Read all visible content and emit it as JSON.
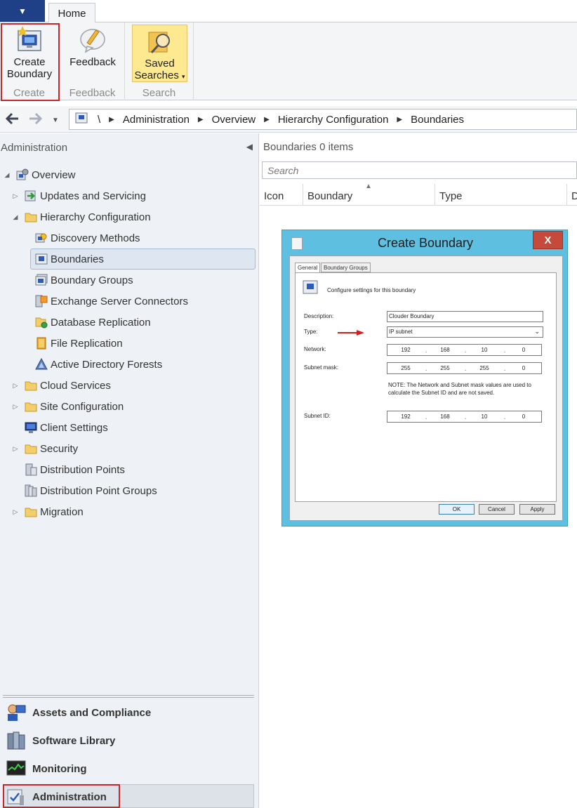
{
  "ribbon": {
    "home_tab": "Home",
    "groups": [
      {
        "label": "Create",
        "button": "Create Boundary"
      },
      {
        "label": "Feedback",
        "button": "Feedback"
      },
      {
        "label": "Search",
        "button": "Saved Searches"
      }
    ],
    "create_line1": "Create",
    "create_line2": "Boundary",
    "saved_line1": "Saved",
    "saved_line2": "Searches"
  },
  "address": {
    "root": "\\",
    "crumbs": [
      "Administration",
      "Overview",
      "Hierarchy Configuration",
      "Boundaries"
    ]
  },
  "nav": {
    "title": "Administration",
    "items": [
      {
        "label": "Overview",
        "icon": "overview-icon"
      },
      {
        "label": "Updates and Servicing",
        "icon": "updates-icon"
      },
      {
        "label": "Hierarchy Configuration",
        "icon": "folder-icon"
      },
      {
        "label": "Discovery Methods",
        "icon": "discovery-icon"
      },
      {
        "label": "Boundaries",
        "icon": "boundary-icon"
      },
      {
        "label": "Boundary Groups",
        "icon": "boundary-group-icon"
      },
      {
        "label": "Exchange Server Connectors",
        "icon": "exchange-icon"
      },
      {
        "label": "Database Replication",
        "icon": "database-icon"
      },
      {
        "label": "File Replication",
        "icon": "file-replication-icon"
      },
      {
        "label": "Active Directory Forests",
        "icon": "forest-icon"
      },
      {
        "label": "Cloud Services",
        "icon": "folder-icon"
      },
      {
        "label": "Site Configuration",
        "icon": "folder-icon"
      },
      {
        "label": "Client Settings",
        "icon": "monitor-icon"
      },
      {
        "label": "Security",
        "icon": "folder-icon"
      },
      {
        "label": "Distribution Points",
        "icon": "server-icon"
      },
      {
        "label": "Distribution Point Groups",
        "icon": "server-group-icon"
      },
      {
        "label": "Migration",
        "icon": "folder-icon"
      }
    ],
    "workspaces": [
      {
        "label": "Assets and Compliance",
        "icon": "assets-icon"
      },
      {
        "label": "Software Library",
        "icon": "library-icon"
      },
      {
        "label": "Monitoring",
        "icon": "monitoring-icon"
      },
      {
        "label": "Administration",
        "icon": "administration-icon"
      }
    ]
  },
  "content": {
    "title": "Boundaries",
    "count": "0 items",
    "search_placeholder": "Search",
    "columns": [
      "Icon",
      "Boundary",
      "Type",
      "D"
    ]
  },
  "dialog": {
    "title": "Create Boundary",
    "close": "X",
    "tabs": [
      "General",
      "Boundary Groups"
    ],
    "intro": "Configure settings for this boundary",
    "description_label": "Description:",
    "description_value": "Clouder Boundary",
    "type_label": "Type:",
    "type_value": "IP subnet",
    "network_label": "Network:",
    "network": [
      "192",
      "168",
      "10",
      "0"
    ],
    "mask_label": "Subnet mask:",
    "mask": [
      "255",
      "255",
      "255",
      "0"
    ],
    "note": "NOTE: The Network and Subnet mask values are used to calculate the Subnet ID and are not saved.",
    "subnet_label": "Subnet ID:",
    "subnet": [
      "192",
      "168",
      "10",
      "0"
    ],
    "ok": "OK",
    "cancel": "Cancel",
    "apply": "Apply"
  },
  "colors": {
    "accent": "#1f3f86",
    "highlight_red": "#c8282d",
    "dialog_frame": "#5fbfe0",
    "close_button": "#c64a3c",
    "saved_searches": "#fde98f"
  }
}
